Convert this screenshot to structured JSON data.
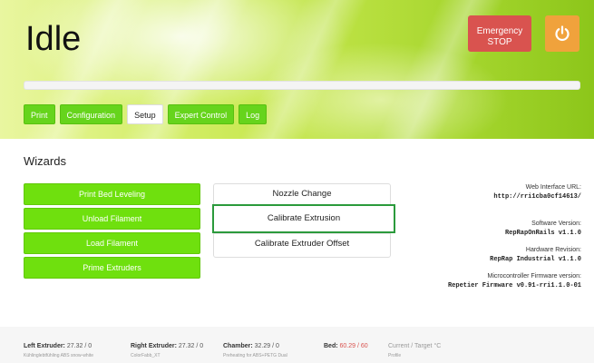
{
  "header": {
    "status_title": "Idle",
    "emergency_stop_line1": "Emergency",
    "emergency_stop_line2": "STOP",
    "progress_fraction": 0,
    "tabs": [
      {
        "label": "Print"
      },
      {
        "label": "Configuration"
      },
      {
        "label": "Setup",
        "active": true
      },
      {
        "label": "Expert Control"
      },
      {
        "label": "Log"
      }
    ]
  },
  "wizards": {
    "title": "Wizards",
    "buttons": [
      {
        "label": "Print Bed Leveling"
      },
      {
        "label": "Unload Filament"
      },
      {
        "label": "Load Filament"
      },
      {
        "label": "Prime Extruders"
      }
    ],
    "list": [
      {
        "label": "Nozzle Change"
      },
      {
        "label": "Calibrate Extrusion",
        "highlighted": true
      },
      {
        "label": "Calibrate Extruder Offset"
      }
    ]
  },
  "info": {
    "web_url_label": "Web Interface URL:",
    "web_url_value": "http://rri1cba0cf14613/",
    "software_label": "Software Version:",
    "software_value": "RepRapOnRails v1.1.0",
    "hardware_label": "Hardware Revision:",
    "hardware_value": "RepRap Industrial v1.1.0",
    "firmware_label": "Microcontroller Firmware version:",
    "firmware_value": "Repetier Firmware v0.91-rri1.1.0-01"
  },
  "footer": {
    "left_extruder_label": "Left Extruder:",
    "left_extruder_value": "27.32 / 0",
    "left_extruder_sub": "Kühlinglebtfühling ABS snow-white",
    "right_extruder_label": "Right Extruder:",
    "right_extruder_value": "27.32 / 0",
    "right_extruder_sub": "ColorFabb_XT",
    "chamber_label": "Chamber:",
    "chamber_value": "32.29 / 0",
    "chamber_sub": "Preheating for ABS+PETG Dual",
    "bed_label": "Bed:",
    "bed_value": "60.29 / 60",
    "legend_line1": "Current / Target °C",
    "legend_line2": "Profile"
  },
  "colors": {
    "green_button": "#6fe00e",
    "emergency": "#d9534f",
    "power": "#f0a23c",
    "highlight_border": "#2b9a3c"
  },
  "icons": [
    "power-icon"
  ]
}
